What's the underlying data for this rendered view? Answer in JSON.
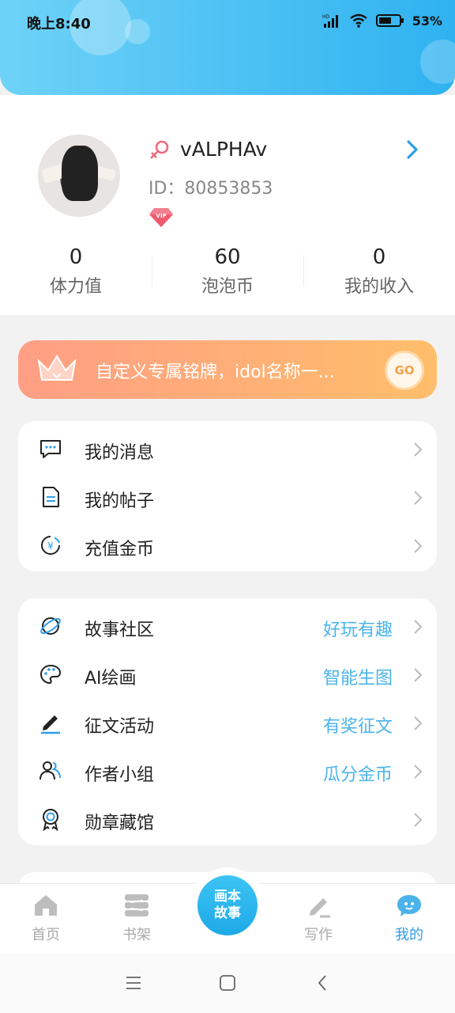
{
  "status_bar": {
    "time": "晚上8:40",
    "battery": "53%"
  },
  "profile": {
    "username": "vALPHAv",
    "id_text": "ID：80853853",
    "vip_badge": "VIP",
    "stats": [
      {
        "value": "0",
        "label": "体力值"
      },
      {
        "value": "60",
        "label": "泡泡币"
      },
      {
        "value": "0",
        "label": "我的收入"
      }
    ]
  },
  "banner": {
    "text": "自定义专属铭牌，idol名称一...",
    "go_label": "GO"
  },
  "menu1": [
    {
      "label": "我的消息",
      "icon": "message-icon"
    },
    {
      "label": "我的帖子",
      "icon": "document-icon"
    },
    {
      "label": "充值金币",
      "icon": "coin-icon"
    }
  ],
  "menu2": [
    {
      "label": "故事社区",
      "hint": "好玩有趣",
      "icon": "planet-icon"
    },
    {
      "label": "AI绘画",
      "hint": "智能生图",
      "icon": "palette-icon"
    },
    {
      "label": "征文活动",
      "hint": "有奖征文",
      "icon": "pen-icon"
    },
    {
      "label": "作者小组",
      "hint": "瓜分金币",
      "icon": "group-icon"
    },
    {
      "label": "勋章藏馆",
      "hint": "",
      "icon": "medal-icon"
    }
  ],
  "bottom_nav": {
    "items": [
      {
        "label": "首页",
        "icon": "home-icon"
      },
      {
        "label": "书架",
        "icon": "bookshelf-icon"
      },
      {
        "label": "写作",
        "icon": "write-icon"
      },
      {
        "label": "我的",
        "icon": "profile-chat-icon"
      }
    ],
    "center_line1": "画本",
    "center_line2": "故事"
  },
  "colors": {
    "accent": "#2e9fe6",
    "header_start": "#6ed2f7",
    "header_end": "#2fb2f0",
    "banner_start": "#ff9e84",
    "banner_end": "#ffbe6b",
    "hint": "#4bb3ea"
  }
}
